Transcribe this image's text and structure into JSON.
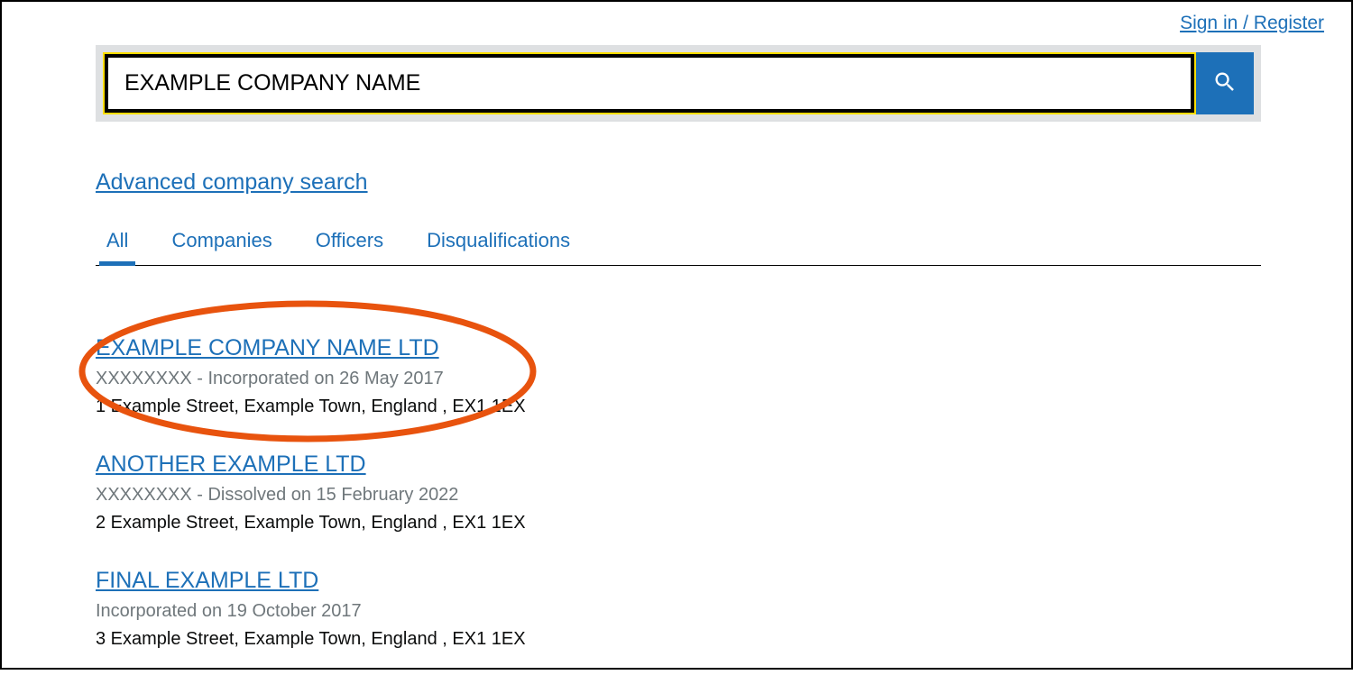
{
  "header": {
    "sign_in": "Sign in / Register"
  },
  "search": {
    "value": "EXAMPLE COMPANY NAME"
  },
  "advanced_search": "Advanced company search",
  "tabs": [
    {
      "label": "All",
      "active": true
    },
    {
      "label": "Companies",
      "active": false
    },
    {
      "label": "Officers",
      "active": false
    },
    {
      "label": "Disqualifications",
      "active": false
    }
  ],
  "results": [
    {
      "title": "EXAMPLE COMPANY NAME LTD",
      "meta": "XXXXXXXX - Incorporated on 26 May 2017",
      "address": "1 Example Street, Example Town, England , EX1 1EX",
      "highlighted": true
    },
    {
      "title": "ANOTHER EXAMPLE LTD",
      "meta": "XXXXXXXX - Dissolved on 15 February 2022",
      "address": "2 Example Street, Example Town, England , EX1 1EX",
      "highlighted": false
    },
    {
      "title": "FINAL EXAMPLE LTD",
      "meta": "Incorporated on 19 October 2017",
      "address": "3 Example Street, Example Town, England , EX1 1EX",
      "highlighted": false
    }
  ]
}
